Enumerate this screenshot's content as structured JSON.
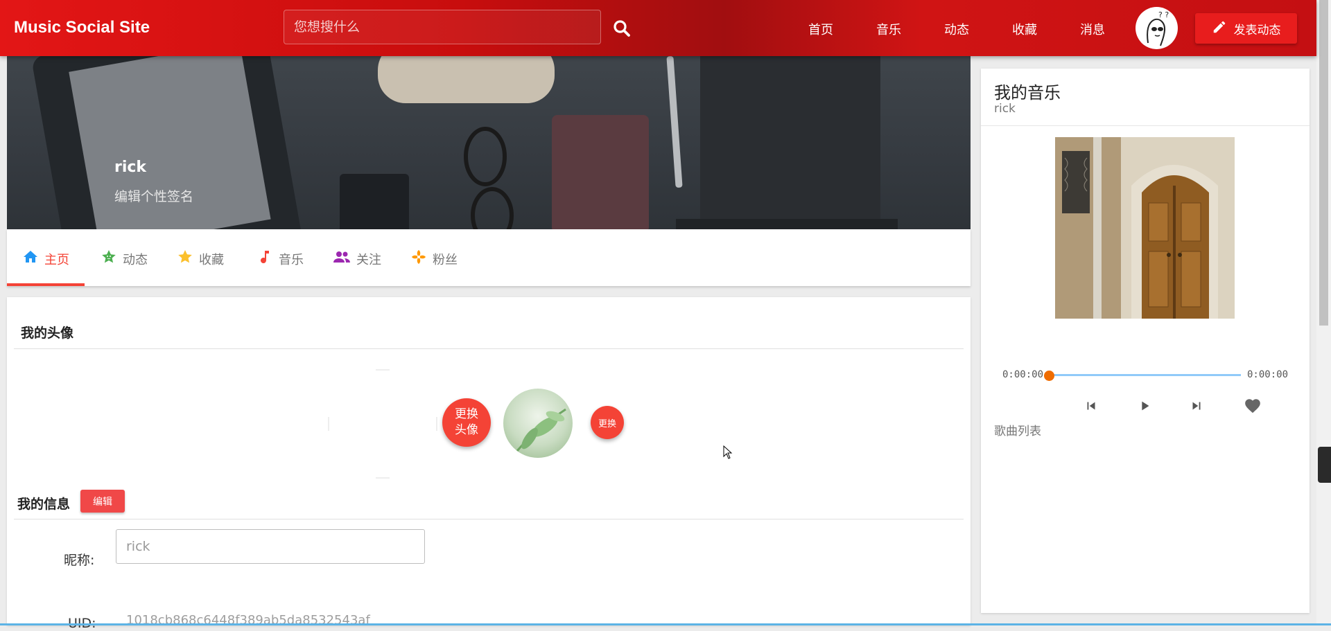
{
  "header": {
    "brand": "Music Social Site",
    "search_placeholder": "您想搜什么",
    "nav": [
      "首页",
      "音乐",
      "动态",
      "收藏",
      "消息"
    ],
    "post_button": "发表动态"
  },
  "profile": {
    "name": "rick",
    "signature": "编辑个性签名"
  },
  "tabs": [
    "主页",
    "动态",
    "收藏",
    "音乐",
    "关注",
    "粉丝"
  ],
  "avatar_section": {
    "title": "我的头像",
    "change_avatar": "更换头像",
    "change": "更换"
  },
  "info_section": {
    "title": "我的信息",
    "edit": "编辑",
    "nickname_label": "昵称:",
    "nickname_value": "rick",
    "uid_label": "UID:",
    "uid_value": "1018cb868c6448f389ab5da8532543af"
  },
  "player": {
    "title": "我的音乐",
    "subtitle": "rick",
    "time_start": "0:00:00",
    "time_end": "0:00:00",
    "progress": 0,
    "playlist_label": "歌曲列表"
  },
  "colors": {
    "accent": "#f44336",
    "header": "#c80d0d",
    "progress_track": "#90caf9",
    "progress_knob": "#ef6c00"
  }
}
